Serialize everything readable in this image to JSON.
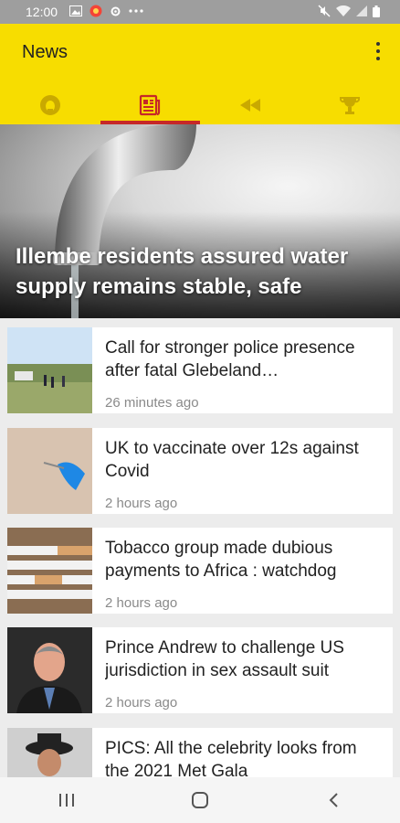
{
  "status_bar": {
    "time": "12:00"
  },
  "app_bar": {
    "title": "News",
    "tabs": [
      {
        "icon": "stadium-icon",
        "active": false
      },
      {
        "icon": "newspaper-icon",
        "active": true
      },
      {
        "icon": "rewind-icon",
        "active": false
      },
      {
        "icon": "trophy-icon",
        "active": false
      }
    ]
  },
  "hero": {
    "headline": "Illembe residents assured water supply remains stable, safe"
  },
  "articles": [
    {
      "headline": "Call for stronger police presence after fatal Glebeland…",
      "time": "26 minutes ago"
    },
    {
      "headline": "UK to vaccinate over 12s against Covid",
      "time": "2 hours ago"
    },
    {
      "headline": "Tobacco group made dubious payments to Africa : watchdog",
      "time": "2 hours ago"
    },
    {
      "headline": "Prince Andrew to challenge US jurisdiction in sex assault suit",
      "time": "2 hours ago"
    },
    {
      "headline": "PICS: All the celebrity looks from the 2021 Met Gala",
      "time": ""
    }
  ],
  "colors": {
    "accent": "#f7dd00",
    "tab_indicator": "#c62828",
    "status_bar": "#9e9e9e"
  }
}
